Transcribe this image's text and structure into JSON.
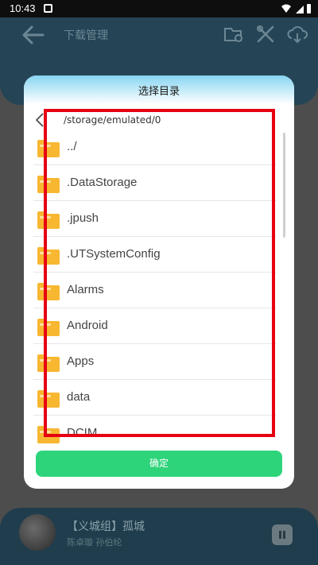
{
  "status_bar": {
    "time": "10:43"
  },
  "header": {
    "title": "下载管理"
  },
  "player": {
    "song": "【义城组】孤城",
    "artist": "陈卓璇  孙伯纶"
  },
  "dialog": {
    "title": "选择目录",
    "path": "/storage/emulated/0",
    "folders": [
      {
        "name": "../"
      },
      {
        "name": ".DataStorage"
      },
      {
        "name": ".jpush"
      },
      {
        "name": ".UTSystemConfig"
      },
      {
        "name": "Alarms"
      },
      {
        "name": "Android"
      },
      {
        "name": "Apps"
      },
      {
        "name": "data"
      },
      {
        "name": "DCIM"
      }
    ],
    "confirm_label": "确定"
  },
  "colors": {
    "header_bg": "#254556",
    "confirm_button": "#2ed47a",
    "folder_icon": "#f7b731",
    "highlight_box": "#e60012"
  },
  "icons": {
    "back": "back-arrow-icon",
    "folder_history": "folder-history-icon",
    "tools": "tools-icon",
    "cloud_download": "cloud-download-icon",
    "folder": "folder-icon"
  }
}
